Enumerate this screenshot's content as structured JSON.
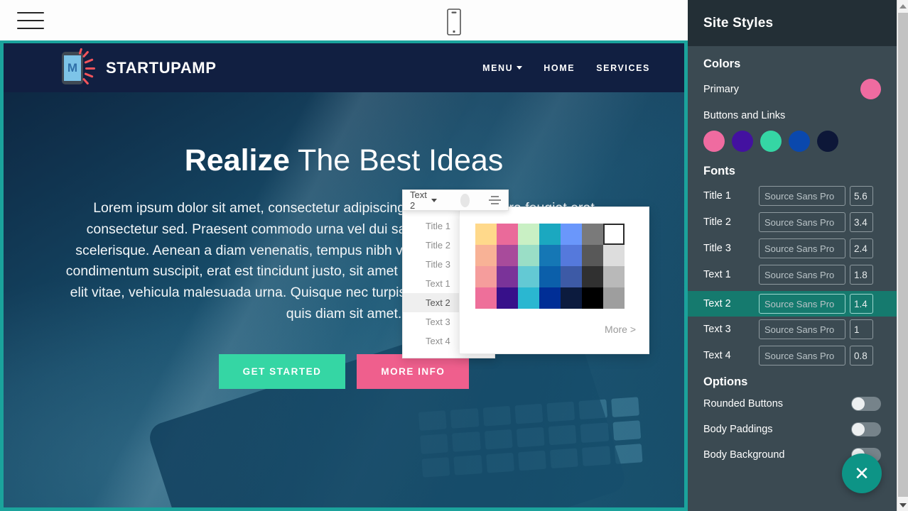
{
  "editor": {
    "hamburger_icon": "hamburger-menu-icon",
    "device_icon": "mobile-device-icon"
  },
  "site": {
    "logo_letter": "M",
    "brand": "STARTUPAMP",
    "nav": [
      {
        "label": "MENU",
        "has_caret": true
      },
      {
        "label": "HOME",
        "has_caret": false
      },
      {
        "label": "SERVICES",
        "has_caret": false
      }
    ],
    "hero": {
      "title_bold": "Realize",
      "title_light": " The Best Ideas",
      "paragraph": "Lorem ipsum dolor sit amet, consectetur adipiscing elit. Nulla pharetra feugiat erat consectetur sed. Praesent commodo urna vel dui sagittis, efficitur venenatis sodales scelerisque. Aenean a diam venenatis, tempus nibh vel, facilisis ante. Phasellus ligula a condimentum suscipit, erat est tincidunt justo, sit amet urna, suscipit ut leo urna, suscipit ut elit vitae, vehicula malesuada urna. Quisque nec turpis nec tellus sagittis. Quisque lacinia quis diam sit amet.",
      "btn_primary": "GET STARTED",
      "btn_secondary": "MORE INFO",
      "btn_primary_color": "#35d6a4",
      "btn_secondary_color": "#ef5f8d"
    }
  },
  "text_toolbar": {
    "selected": "Text 2",
    "swatch_color": "#e6e6e6",
    "align_icon": "align-center-icon",
    "caret_icon": "chevron-down-icon",
    "options": [
      "Title 1",
      "Title 2",
      "Title 3",
      "Text 1",
      "Text 2",
      "Text 3",
      "Text 4"
    ]
  },
  "palette": {
    "more_label": "More >",
    "selected_index": 6,
    "colors": [
      "#ffd98b",
      "#ea6a9a",
      "#c9f0c4",
      "#1ba8c0",
      "#6a97fb",
      "#7a7a7a",
      "#ffffff",
      "#f8b296",
      "#a84b9b",
      "#9adec6",
      "#1577b5",
      "#5579dc",
      "#585858",
      "#dddddd",
      "#f59d9c",
      "#7a3399",
      "#63c9d4",
      "#0b5faa",
      "#3d5aa6",
      "#303030",
      "#b9b9b9",
      "#ee6f9a",
      "#37108a",
      "#2ab7d1",
      "#002e96",
      "#0c1b3e",
      "#000000",
      "#9e9e9e"
    ]
  },
  "sidebar": {
    "title": "Site Styles",
    "colors_heading": "Colors",
    "primary_label": "Primary",
    "primary_color": "#ef6ba0",
    "buttons_links_label": "Buttons and Links",
    "button_colors": [
      "#ef6ba0",
      "#4311a0",
      "#35d6a4",
      "#0a48ad",
      "#0d1738"
    ],
    "fonts_heading": "Fonts",
    "fonts": [
      {
        "name": "Title 1",
        "family": "Source Sans Pro",
        "size": "5.6",
        "active": false
      },
      {
        "name": "Title 2",
        "family": "Source Sans Pro",
        "size": "3.4",
        "active": false
      },
      {
        "name": "Title 3",
        "family": "Source Sans Pro",
        "size": "2.4",
        "active": false
      },
      {
        "name": "Text 1",
        "family": "Source Sans Pro",
        "size": "1.8",
        "active": false
      },
      {
        "name": "Text 2",
        "family": "Source Sans Pro",
        "size": "1.4",
        "active": true
      },
      {
        "name": "Text 3",
        "family": "Source Sans Pro",
        "size": "1",
        "active": false
      },
      {
        "name": "Text 4",
        "family": "Source Sans Pro",
        "size": "0.8",
        "active": false
      }
    ],
    "options_heading": "Options",
    "options": [
      {
        "label": "Rounded Buttons",
        "on": false
      },
      {
        "label": "Body Paddings",
        "on": false
      },
      {
        "label": "Body Background",
        "on": false
      }
    ],
    "close_label": "✕",
    "accent_color": "#0d9486"
  }
}
